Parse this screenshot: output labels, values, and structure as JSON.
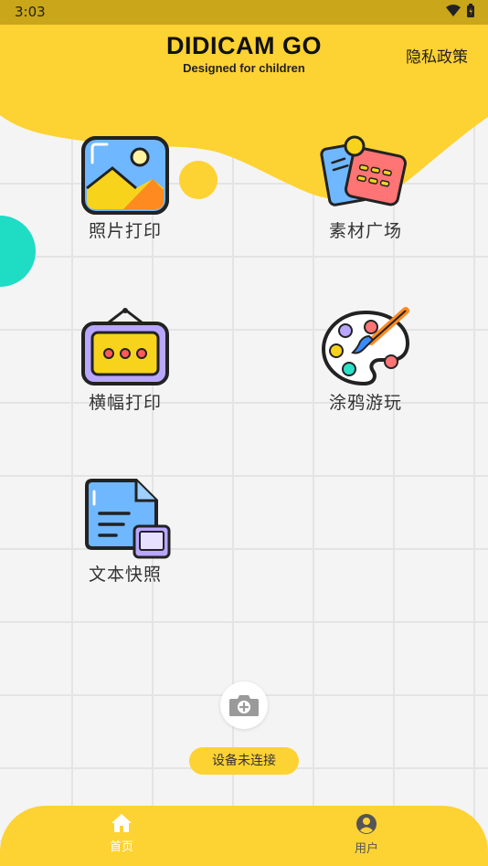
{
  "status_bar": {
    "time": "3:03"
  },
  "header": {
    "title": "DIDICAM GO",
    "subtitle": "Designed for children",
    "privacy_link": "隐私政策"
  },
  "tiles": [
    {
      "label": "照片打印",
      "icon": "photo-icon"
    },
    {
      "label": "素材广场",
      "icon": "materials-icon"
    },
    {
      "label": "横幅打印",
      "icon": "banner-icon"
    },
    {
      "label": "涂鸦游玩",
      "icon": "palette-icon"
    },
    {
      "label": "文本快照",
      "icon": "document-icon"
    }
  ],
  "device": {
    "status": "设备未连接",
    "icon": "camera-add-icon"
  },
  "bottom_nav": {
    "items": [
      {
        "label": "首页",
        "icon": "home-icon",
        "active": true
      },
      {
        "label": "用户",
        "icon": "user-icon",
        "active": false
      }
    ]
  },
  "colors": {
    "accent": "#fdd233",
    "status_bar": "#c9a61a",
    "background": "#f4f4f4",
    "teal": "#1fdcc5"
  }
}
